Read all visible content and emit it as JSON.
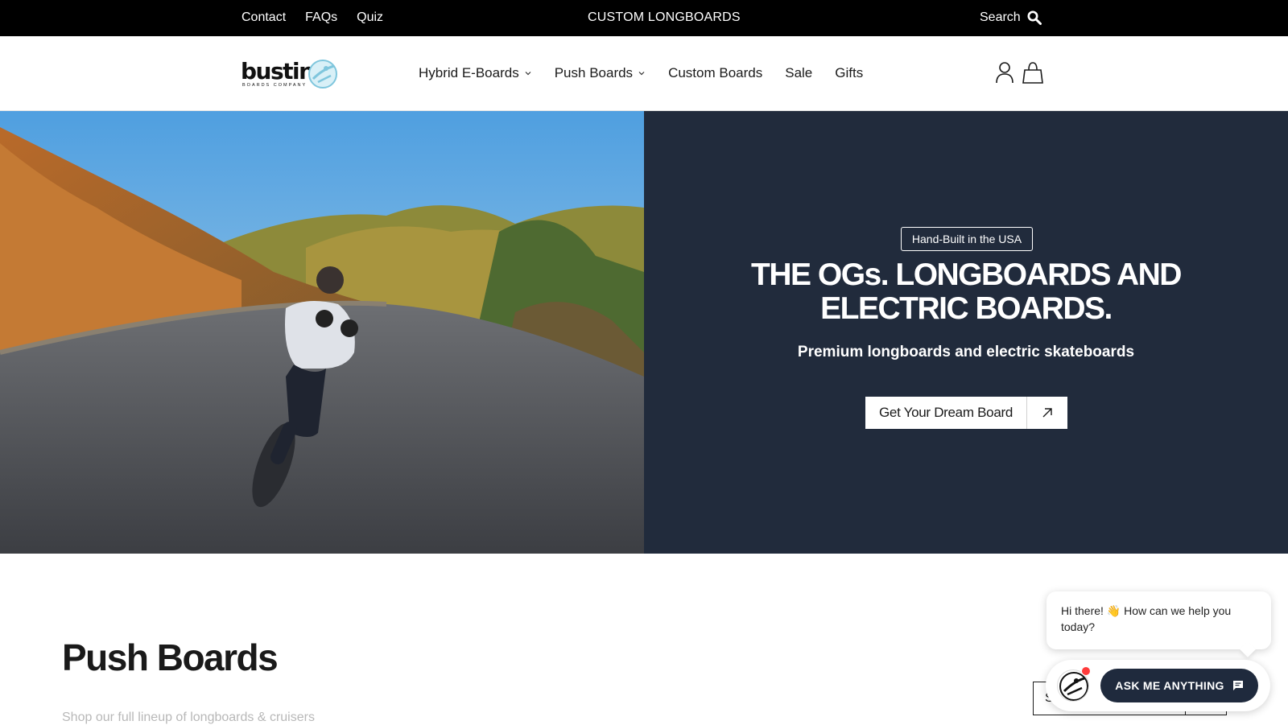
{
  "topbar": {
    "links": [
      "Contact",
      "FAQs",
      "Quiz"
    ],
    "center_link": "CUSTOM LONGBOARDS",
    "search_label": "Search"
  },
  "header": {
    "logo_text": "bustin",
    "logo_subtext": "BOARDS COMPANY",
    "nav": [
      {
        "label": "Hybrid E-Boards",
        "dropdown": true
      },
      {
        "label": "Push Boards",
        "dropdown": true
      },
      {
        "label": "Custom Boards",
        "dropdown": false
      },
      {
        "label": "Sale",
        "dropdown": false
      },
      {
        "label": "Gifts",
        "dropdown": false
      }
    ],
    "icons": [
      "account-icon",
      "cart-icon"
    ]
  },
  "hero": {
    "tag": "Hand-Built in the USA",
    "title": "THE OGs. LONGBOARDS AND ELECTRIC BOARDS.",
    "subtitle": "Premium longboards and electric skateboards",
    "cta_label": "Get Your Dream Board",
    "panel_color": "#212b3c"
  },
  "section": {
    "title": "Push Boards",
    "description": "Shop our full lineup of longboards & cruisers",
    "sort_label": "S"
  },
  "chat": {
    "greeting": "Hi there! 👋 How can we help you today?",
    "button_label": "ASK ME ANYTHING",
    "accent": "#1f2a3d",
    "notification_color": "#ff3b3b"
  }
}
